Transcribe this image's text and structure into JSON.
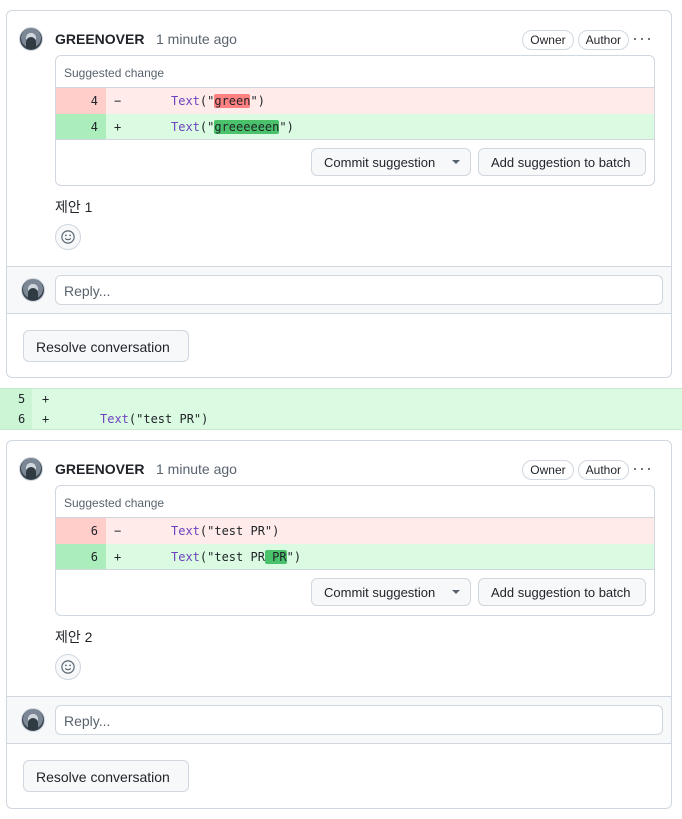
{
  "threads": [
    {
      "author": "GREENOVER",
      "time": "1 minute ago",
      "badges": [
        "Owner",
        "Author"
      ],
      "suggestion_title": "Suggested change",
      "del": {
        "line": "4",
        "sign": "−",
        "prefix": "Text",
        "pre": "(\"",
        "hl": "green",
        "post": "\")"
      },
      "add": {
        "line": "4",
        "sign": "+",
        "prefix": "Text",
        "pre": "(\"",
        "hl": "greeeeeen",
        "post": "\")"
      },
      "commit_label": "Commit suggestion",
      "batch_label": "Add suggestion to batch",
      "body": "제안 1",
      "reply_placeholder": "Reply...",
      "resolve_label": "Resolve conversation"
    },
    {
      "author": "GREENOVER",
      "time": "1 minute ago",
      "badges": [
        "Owner",
        "Author"
      ],
      "suggestion_title": "Suggested change",
      "del": {
        "line": "6",
        "sign": "−",
        "prefix": "Text",
        "pre": "(\"test PR\")",
        "hl": "",
        "post": ""
      },
      "add": {
        "line": "6",
        "sign": "+",
        "prefix": "Text",
        "pre": "(\"test PR",
        "hl": " PR",
        "post": "\")"
      },
      "commit_label": "Commit suggestion",
      "batch_label": "Add suggestion to batch",
      "body": "제안 2",
      "reply_placeholder": "Reply...",
      "resolve_label": "Resolve conversation"
    }
  ],
  "file_diff": [
    {
      "line": "5",
      "sign": "+",
      "prefix": "",
      "rest": ""
    },
    {
      "line": "6",
      "sign": "+",
      "prefix": "Text",
      "rest": "(\"test PR\")"
    }
  ],
  "icons": {
    "more": "kebab-horizontal-icon",
    "reaction": "smiley-icon",
    "caret": "triangle-down-icon"
  },
  "colors": {
    "deletion_bg": "#ffebe9",
    "addition_bg": "#dafbe1",
    "keyword": "#6f42c1",
    "border": "#d0d7de"
  }
}
